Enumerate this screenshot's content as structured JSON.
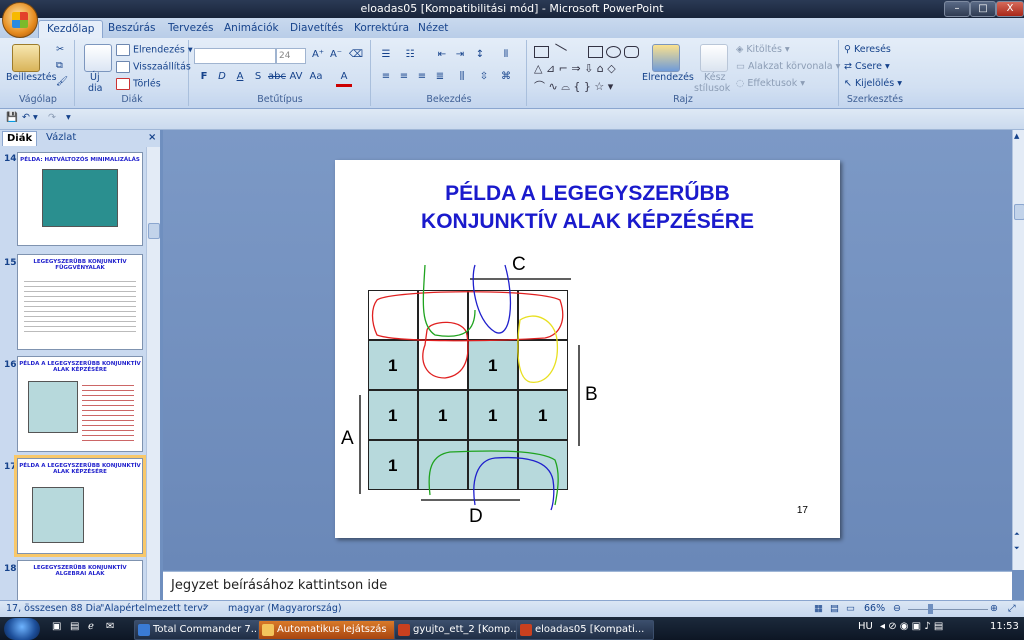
{
  "window": {
    "title": "eloadas05 [Kompatibilitási mód] - Microsoft PowerPoint",
    "minimize": "–",
    "maximize": "□",
    "close": "X"
  },
  "ribbon_tabs": [
    "Kezdőlap",
    "Beszúrás",
    "Tervezés",
    "Animációk",
    "Diavetítés",
    "Korrektúra",
    "Nézet"
  ],
  "ribbon": {
    "clipboard": {
      "label": "Vágólap",
      "paste": "Beillesztés"
    },
    "slides": {
      "label": "Diák",
      "new_slide": "Új",
      "new_slide2": "dia",
      "layout": "Elrendezés",
      "reset": "Visszaállítás",
      "delete": "Törlés"
    },
    "font": {
      "label": "Betűtípus",
      "font_name": "",
      "font_size": "24"
    },
    "paragraph": {
      "label": "Bekezdés"
    },
    "drawing": {
      "label": "Rajz",
      "arrange": "Elrendezés",
      "quick_styles": "Kész",
      "quick_styles2": "stílusok",
      "fill": "Kitöltés",
      "outline": "Alakzat körvonala",
      "effects": "Effektusok"
    },
    "editing": {
      "label": "Szerkesztés",
      "find": "Keresés",
      "replace": "Csere",
      "select": "Kijelölés"
    }
  },
  "pane": {
    "tab_slides": "Diák",
    "tab_outline": "Vázlat",
    "close": "×"
  },
  "thumbnails": [
    {
      "num": "14",
      "title": "PÉLDA: HATVÁLTOZÓS MINIMALIZÁLÁS"
    },
    {
      "num": "15",
      "title": "LEGEGYSZERŰBB KONJUNKTÍV FÜGGVÉNYALAK"
    },
    {
      "num": "16",
      "title": "PÉLDA A LEGEGYSZERŰBB KONJUNKTÍV ALAK KÉPZÉSÉRE"
    },
    {
      "num": "17",
      "title": "PÉLDA A LEGEGYSZERŰBB KONJUNKTÍV ALAK KÉPZÉSÉRE"
    },
    {
      "num": "18",
      "title": "LEGEGYSZERŰBB KONJUNKTÍV ALGEBRAI ALAK"
    }
  ],
  "slide": {
    "title_line1": "PÉLDA A LEGEGYSZERŰBB",
    "title_line2": "KONJUNKTÍV ALAK KÉPZÉSÉRE",
    "label_a": "A",
    "label_b": "B",
    "label_c": "C",
    "label_d": "D",
    "slide_number": "17",
    "kmap": [
      [
        "",
        "",
        "",
        ""
      ],
      [
        "1",
        "",
        "1",
        ""
      ],
      [
        "1",
        "1",
        "1",
        "1"
      ],
      [
        "1",
        "",
        "",
        ""
      ]
    ]
  },
  "notes_placeholder": "Jegyzet beírásához kattintson ide",
  "statusbar": {
    "slide_info": "17, összesen 88 Dia",
    "theme": "\"Alapértelmezett terv\"",
    "language": "magyar (Magyarország)",
    "zoom": "66%"
  },
  "taskbar": {
    "tasks": [
      "Total Commander 7....",
      "Automatikus lejátszás",
      "gyujto_ett_2 [Komp...",
      "eloadas05 [Kompati..."
    ],
    "lang": "HU",
    "time": "11:53"
  }
}
